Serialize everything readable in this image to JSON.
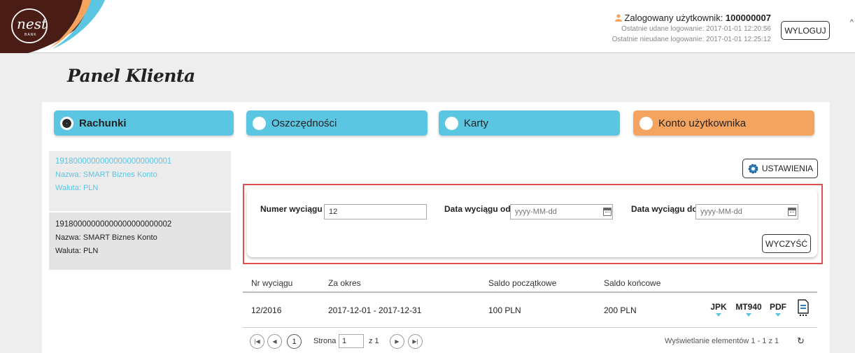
{
  "header": {
    "logo_text": "nest",
    "logo_subtext": "BANK",
    "user_label": "Zalogowany użytkownik: ",
    "user_id": "100000007",
    "last_success": "Ostatnie udane logowanie: 2017-01-01 12:20:56",
    "last_failed": "Ostatnie nieudane logowanie: 2017-01-01 12:25:12",
    "logout_label": "WYLOGUJ"
  },
  "page_title": "Panel Klienta",
  "tabs": [
    {
      "label": "Rachunki",
      "active": true,
      "color": "#5bc6e2"
    },
    {
      "label": "Oszczędności",
      "active": false,
      "color": "#5bc6e2"
    },
    {
      "label": "Karty",
      "active": false,
      "color": "#5bc6e2"
    },
    {
      "label": "Konto użytkownika",
      "active": false,
      "color": "#f5a460"
    }
  ],
  "accounts": [
    {
      "number": "19180000000000000000000001",
      "name": "Nazwa: SMART Biznes Konto",
      "currency": "Waluta: PLN"
    },
    {
      "number": "19180000000000000000000002",
      "name": "Nazwa: SMART Biznes Konto",
      "currency": "Waluta: PLN"
    }
  ],
  "settings_label": "USTAWIENIA",
  "filter": {
    "number_label": "Numer wyciągu",
    "number_value": "12",
    "date_from_label": "Data wyciągu od",
    "date_from_placeholder": "yyyy-MM-dd",
    "date_to_label": "Data wyciągu do",
    "date_to_placeholder": "yyyy-MM-dd",
    "clear_label": "WYCZYŚĆ"
  },
  "table": {
    "headers": [
      "Nr wyciągu",
      "Za okres",
      "Saldo początkowe",
      "Saldo końcowe"
    ],
    "rows": [
      {
        "nr": "12/2016",
        "period": "2017-12-01 - 2017-12-31",
        "start": "100 PLN",
        "end": "200 PLN",
        "downloads": [
          "JPK",
          "MT940",
          "PDF"
        ]
      }
    ]
  },
  "pager": {
    "first_icon": "first-page-icon",
    "prev_icon": "prev-page-icon",
    "current_page": "1",
    "page_label": "Strona",
    "page_value": "1",
    "of_label": "z 1",
    "next_icon": "next-page-icon",
    "last_icon": "last-page-icon",
    "info": "Wyświetlanie elementów 1 - 1 z 1",
    "refresh_icon": "refresh-icon"
  },
  "colors": {
    "accent_blue": "#5bc6e2",
    "accent_orange": "#f5a460",
    "logo_dark": "#4a1c16",
    "filter_border": "#e05050"
  }
}
